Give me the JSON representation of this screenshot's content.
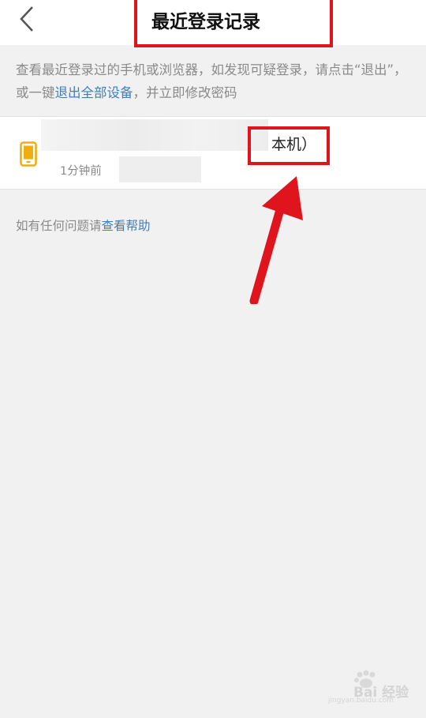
{
  "header": {
    "title": "最近登录记录",
    "back_icon": "chevron-left-icon"
  },
  "notice": {
    "text_before": "查看最近登录过的手机或浏览器，如发现可疑登录，请点击“退出”，或一键",
    "link": "退出全部设备",
    "text_after": "，并立即修改密码"
  },
  "session": {
    "device_suffix": "本机）",
    "time": "1分钟前",
    "icon": "smartphone-icon",
    "icon_color": "#f0ae0e"
  },
  "help": {
    "prefix": "如有任何问题请",
    "link": "查看帮助"
  },
  "annotation": {
    "color": "#e0141c"
  },
  "watermark": {
    "text": "Bai 经验",
    "url": "jingyan.baidu.com"
  }
}
